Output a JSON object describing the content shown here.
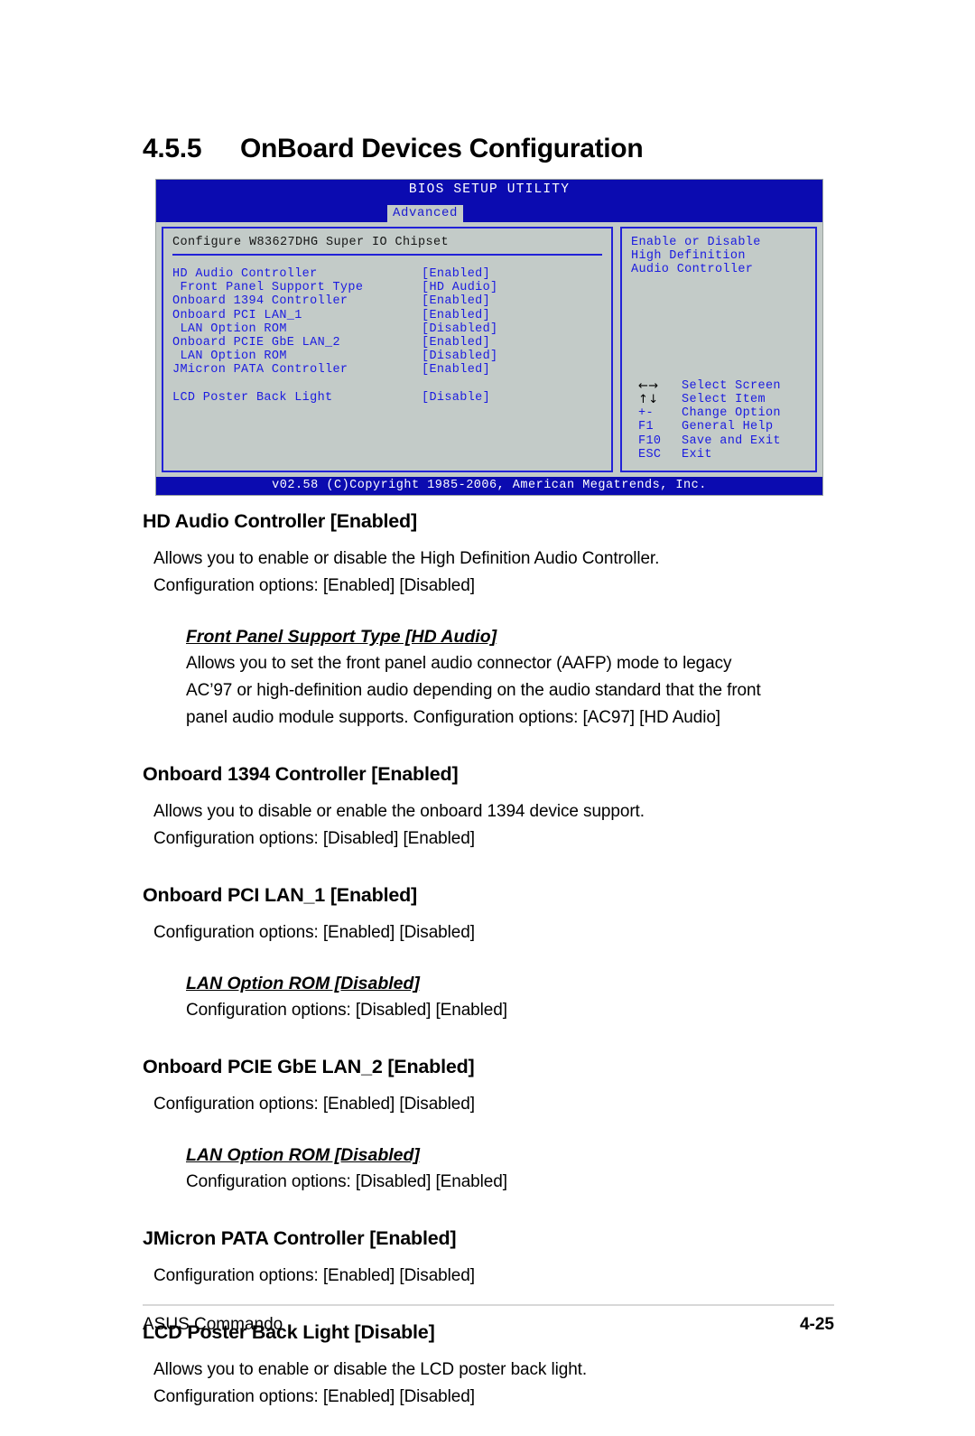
{
  "section": {
    "number": "4.5.5",
    "title": "OnBoard Devices Configuration"
  },
  "bios": {
    "title": "BIOS SETUP UTILITY",
    "tab": "Advanced",
    "config_header": "Configure W83627DHG Super IO Chipset",
    "options": [
      {
        "label": "HD Audio Controller",
        "value": "[Enabled]"
      },
      {
        "label": " Front Panel Support Type",
        "value": "[HD Audio]"
      },
      {
        "label": "Onboard 1394 Controller",
        "value": "[Enabled]"
      },
      {
        "label": "Onboard PCI LAN_1",
        "value": "[Enabled]"
      },
      {
        "label": " LAN Option ROM",
        "value": "[Disabled]"
      },
      {
        "label": "Onboard PCIE GbE LAN_2",
        "value": "[Enabled]"
      },
      {
        "label": " LAN Option ROM",
        "value": "[Disabled]"
      },
      {
        "label": "JMicron PATA Controller",
        "value": "[Enabled]"
      }
    ],
    "option_last": {
      "label": "LCD Poster Back Light",
      "value": "[Disable]"
    },
    "help_lines": [
      "Enable or Disable",
      "High Definition",
      "Audio Controller"
    ],
    "keys": [
      {
        "key": "←→",
        "action": "Select Screen",
        "glyph": true
      },
      {
        "key": "↑↓",
        "action": "Select Item",
        "glyph": true
      },
      {
        "key": "+-",
        "action": "Change Option",
        "glyph": false
      },
      {
        "key": "F1",
        "action": "General Help",
        "glyph": false
      },
      {
        "key": "F10",
        "action": "Save and Exit",
        "glyph": false
      },
      {
        "key": "ESC",
        "action": "Exit",
        "glyph": false
      }
    ],
    "footer": "v02.58 (C)Copyright 1985-2006, American Megatrends, Inc.",
    "colors": {
      "title_bar": "#0b0bb0",
      "panel_bg": "#c3cbc8",
      "text_blue": "#1b1be0",
      "border_blue": "#2222d8"
    }
  },
  "items": {
    "hd_audio": {
      "heading": "HD Audio Controller [Enabled]",
      "line1": "Allows you to enable or disable the High Definition Audio Controller.",
      "line2": "Configuration options: [Enabled] [Disabled]",
      "sub": {
        "heading": "Front Panel Support Type [HD Audio]",
        "line1": "Allows you to set the front panel audio connector (AAFP) mode to legacy",
        "line2": "AC’97 or high-definition audio depending on the audio standard that the front",
        "line3": "panel audio module supports. Configuration options: [AC97] [HD Audio]"
      }
    },
    "onboard_1394": {
      "heading": "Onboard 1394 Controller [Enabled]",
      "line1": "Allows you to disable or enable the onboard 1394 device support.",
      "line2": "Configuration options: [Disabled] [Enabled]"
    },
    "pci_lan1": {
      "heading": "Onboard PCI LAN_1 [Enabled]",
      "line1": "Configuration options: [Enabled] [Disabled]",
      "sub": {
        "heading": "LAN Option ROM [Disabled]",
        "line1": "Configuration options: [Disabled] [Enabled]"
      }
    },
    "pcie_lan2": {
      "heading": "Onboard PCIE GbE LAN_2 [Enabled]",
      "line1": "Configuration options: [Enabled] [Disabled]",
      "sub": {
        "heading": "LAN Option ROM [Disabled]",
        "line1": "Configuration options: [Disabled] [Enabled]"
      }
    },
    "jmicron": {
      "heading": "JMicron PATA Controller [Enabled]",
      "line1": "Configuration options: [Enabled] [Disabled]"
    },
    "lcd_poster": {
      "heading": "LCD Poster Back Light [Disable]",
      "line1": "Allows you to enable or disable the LCD poster back light.",
      "line2": "Configuration options: [Enabled] [Disabled]"
    }
  },
  "page_footer": {
    "left": "ASUS Commando",
    "right": "4-25"
  }
}
